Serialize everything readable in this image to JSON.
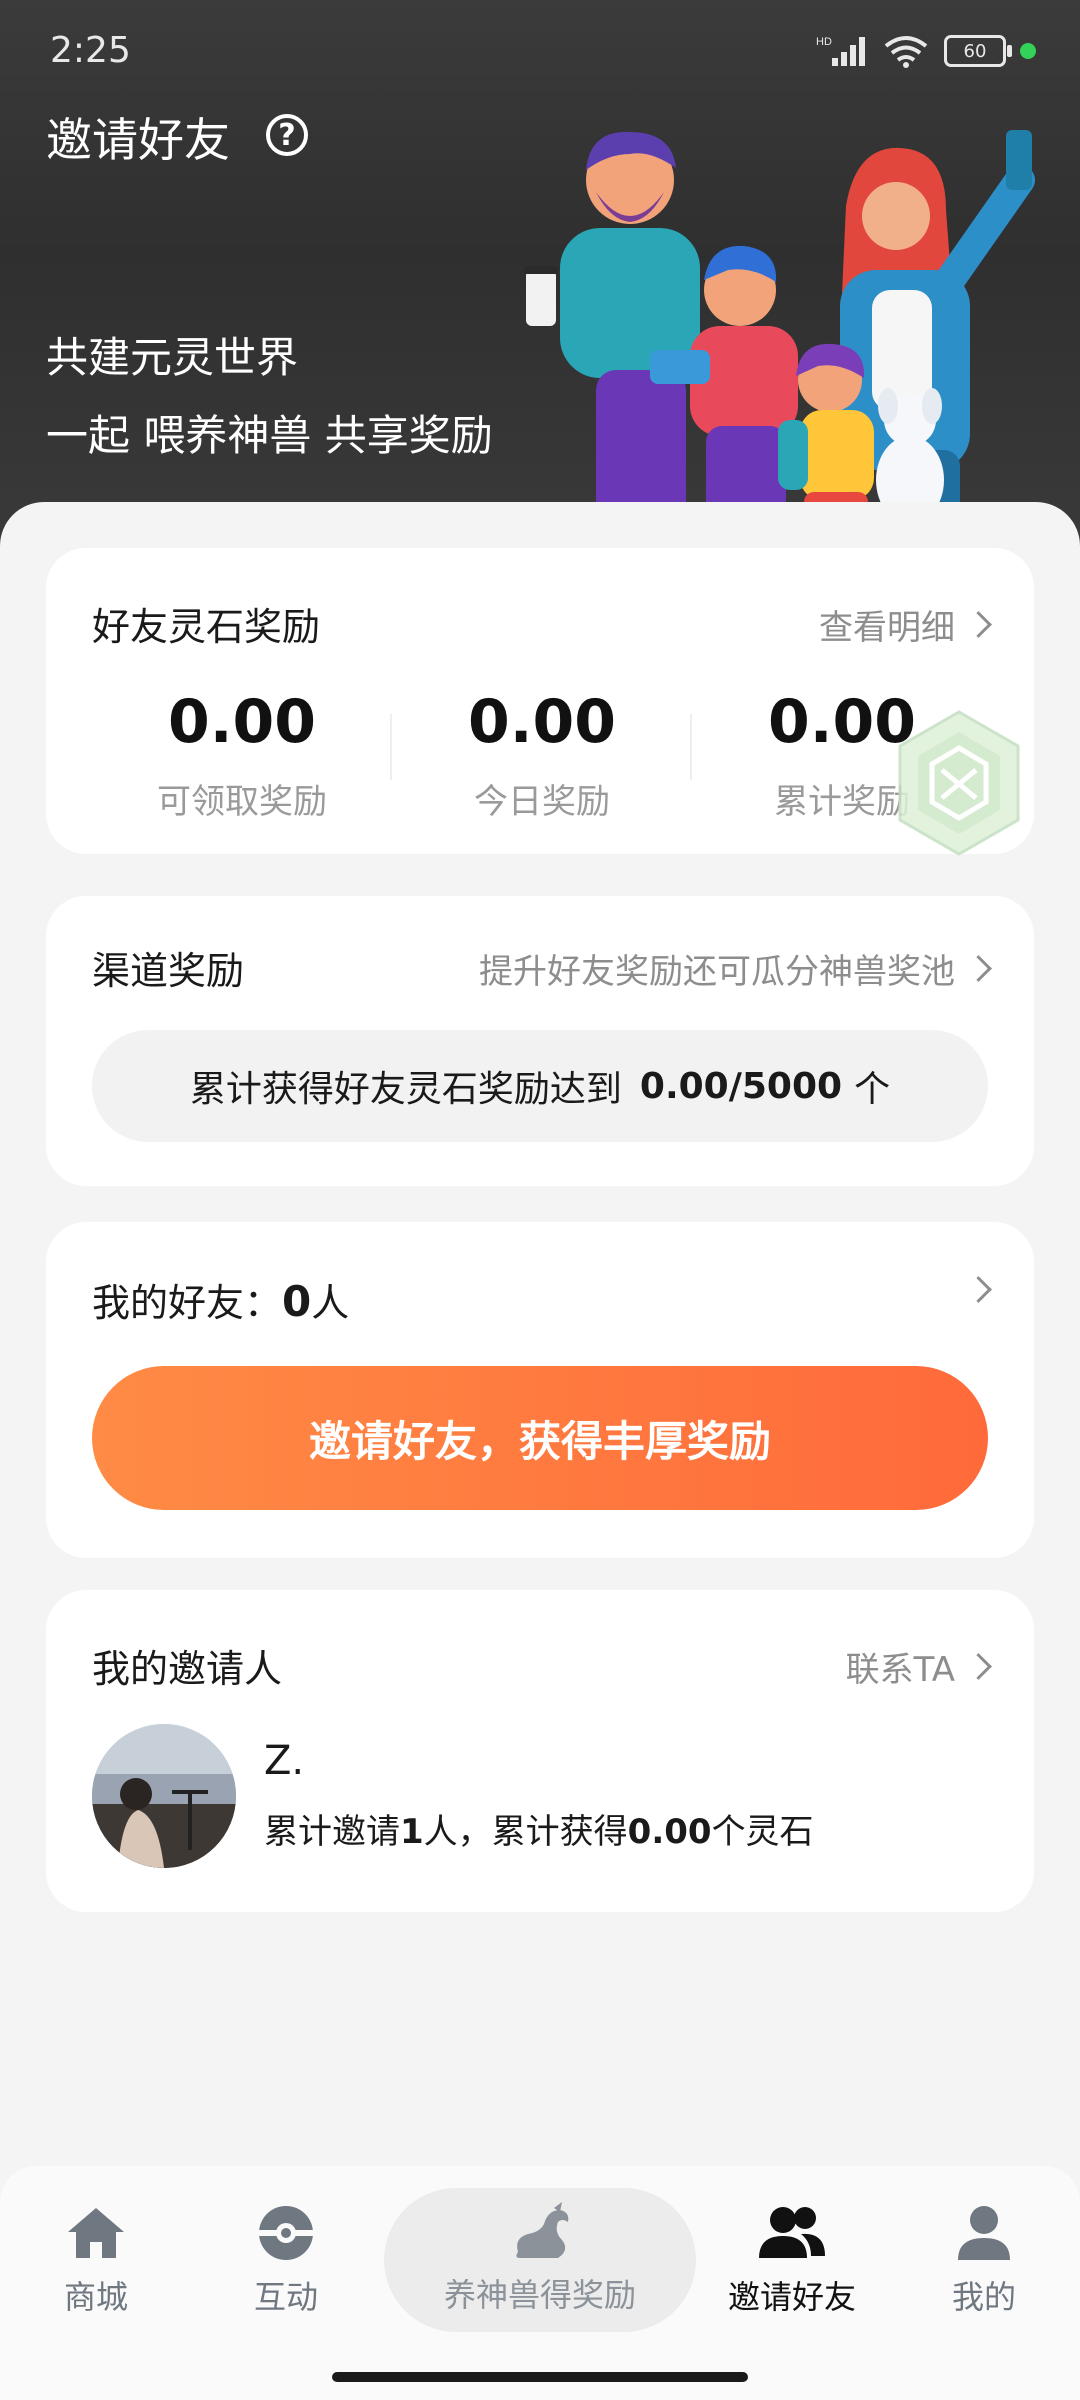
{
  "status_bar": {
    "time": "2:25",
    "battery": "60",
    "network_label": "HD"
  },
  "header": {
    "title": "邀请好友",
    "help_icon": "question-circle-icon",
    "slogan_line1": "共建元灵世界",
    "slogan_line2": "一起 喂养神兽 共享奖励"
  },
  "reward_card": {
    "title": "好友灵石奖励",
    "link": "查看明细",
    "stats": [
      {
        "value": "0.00",
        "label": "可领取奖励"
      },
      {
        "value": "0.00",
        "label": "今日奖励"
      },
      {
        "value": "0.00",
        "label": "累计奖励"
      }
    ]
  },
  "channel_card": {
    "title": "渠道奖励",
    "link": "提升好友奖励还可瓜分神兽奖池",
    "progress_prefix": "累计获得好友灵石奖励达到",
    "progress_value": "0.00/5000",
    "progress_unit": "个"
  },
  "friends_card": {
    "label": "我的好友：",
    "count": "0",
    "unit": "人",
    "invite_button": "邀请好友，获得丰厚奖励"
  },
  "inviter_card": {
    "title": "我的邀请人",
    "link": "联系TA",
    "name": "Z.",
    "desc_part1": "累计邀请",
    "invited_count": "1",
    "desc_part2": "人，累计获得",
    "earned": "0.00",
    "desc_part3": "个灵石"
  },
  "bottom_nav": {
    "items": [
      {
        "label": "商城",
        "icon": "home-icon"
      },
      {
        "label": "互动",
        "icon": "pokeball-icon"
      },
      {
        "label": "养神兽得奖励",
        "icon": "dragon-icon"
      },
      {
        "label": "邀请好友",
        "icon": "friends-icon"
      },
      {
        "label": "我的",
        "icon": "user-icon"
      }
    ],
    "active_index": 3
  },
  "colors": {
    "accent_orange_start": "#ff8b45",
    "accent_orange_end": "#ff6a3a",
    "header_bg": "#333333",
    "page_bg": "#f4f4f4"
  }
}
